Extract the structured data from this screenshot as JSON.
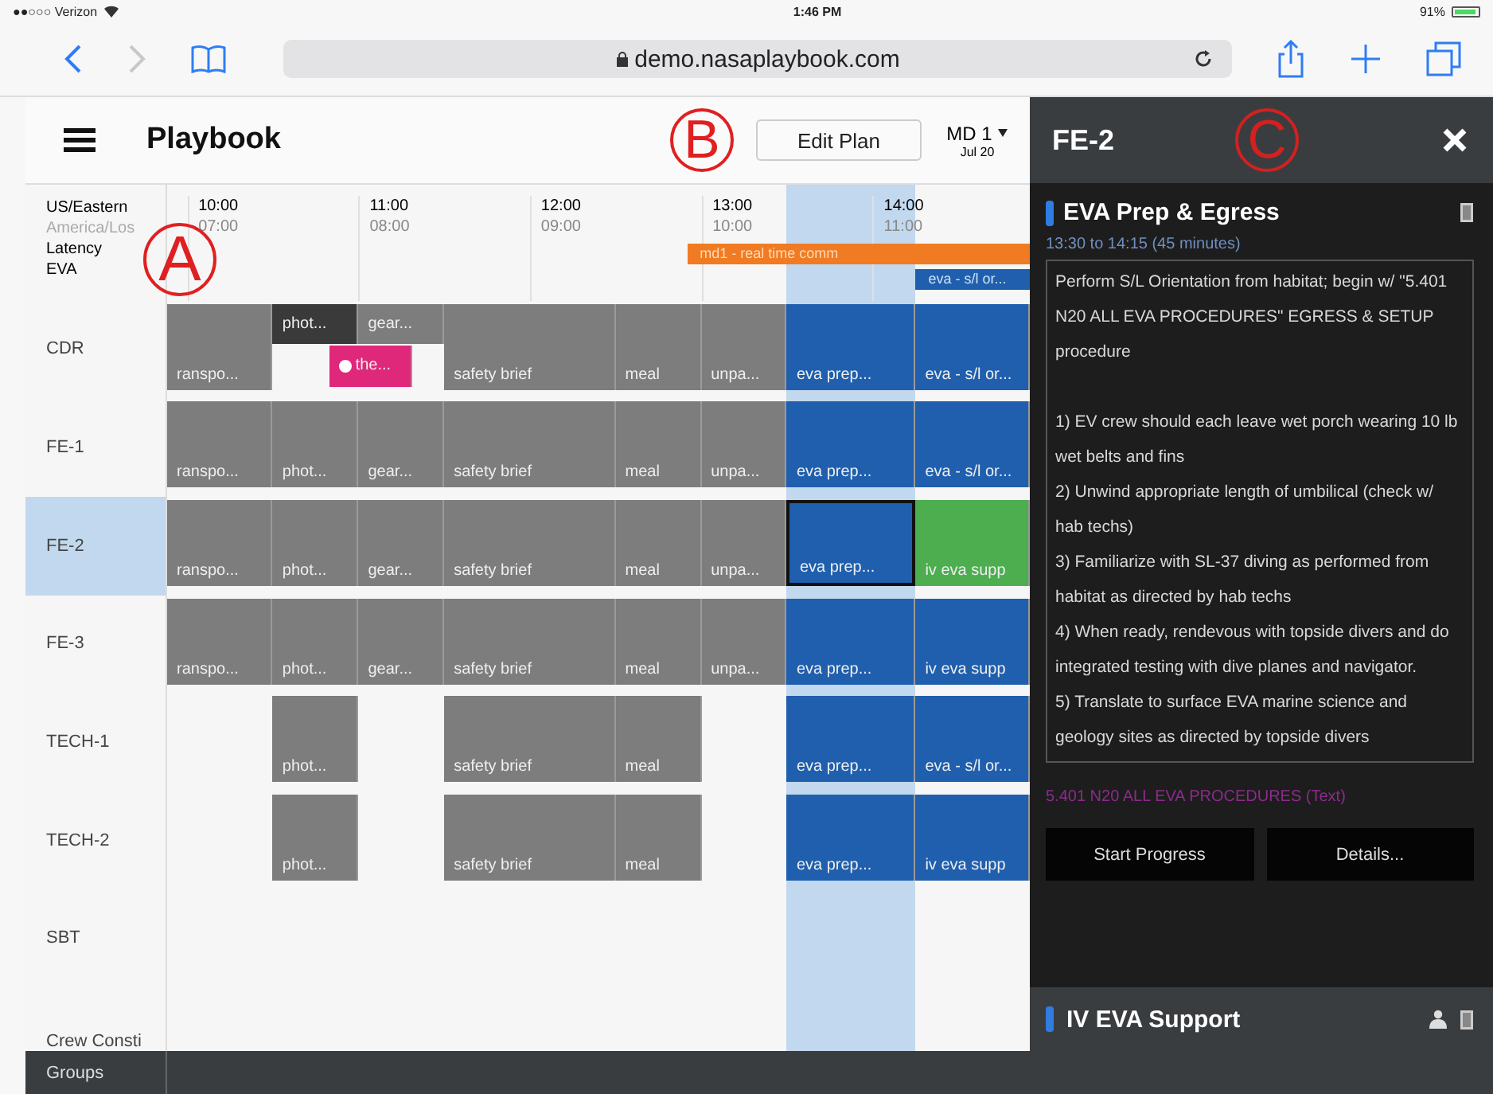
{
  "status_bar": {
    "carrier": "●●○○○ Verizon",
    "time": "1:46 PM",
    "battery": "91%"
  },
  "browser": {
    "url": "demo.nasaplaybook.com",
    "forward_disabled": true
  },
  "header": {
    "title": "Playbook",
    "annotation": "B",
    "edit_button": "Edit Plan",
    "day": "MD 1",
    "date": "Jul 20"
  },
  "timeline": {
    "annotation": "A",
    "zones": [
      "US/Eastern",
      "America/Los"
    ],
    "hours": [
      {
        "time": "10:00",
        "alt": "07:00"
      },
      {
        "time": "11:00",
        "alt": "08:00"
      },
      {
        "time": "12:00",
        "alt": "09:00"
      },
      {
        "time": "13:00",
        "alt": "10:00"
      },
      {
        "time": "14:00",
        "alt": "11:00"
      }
    ],
    "bands": [
      {
        "label": "Latency",
        "bar": {
          "text": "md1 - real time comm",
          "color": "#f07b22"
        }
      },
      {
        "label": "EVA",
        "bar": {
          "text": "eva - s/l or...",
          "color": "#1f5fae"
        }
      }
    ],
    "rows": [
      {
        "label": "CDR",
        "selected": false,
        "blocks": [
          {
            "text": "ranspo...",
            "kind": "full",
            "color": "#7d7d7d",
            "selected": false,
            "dot": false
          },
          {
            "text": "phot...",
            "kind": "upper",
            "color": "#3a3a3a",
            "selected": false,
            "dot": false
          },
          {
            "text": "gear...",
            "kind": "upper",
            "color": "#7d7d7d",
            "selected": false,
            "dot": false
          },
          {
            "text": "the...",
            "kind": "lower",
            "color": "#e0287a",
            "selected": false,
            "dot": true
          },
          {
            "text": "safety brief",
            "kind": "full",
            "color": "#7d7d7d",
            "selected": false,
            "dot": false
          },
          {
            "text": "meal",
            "kind": "full",
            "color": "#7d7d7d",
            "selected": false,
            "dot": false
          },
          {
            "text": "unpa...",
            "kind": "full",
            "color": "#7d7d7d",
            "selected": false,
            "dot": false
          },
          {
            "text": "eva prep...",
            "kind": "full",
            "color": "#1f5fae",
            "selected": false,
            "dot": false
          },
          {
            "text": "eva - s/l or...",
            "kind": "full",
            "color": "#1f5fae",
            "selected": false,
            "dot": false
          }
        ]
      },
      {
        "label": "FE-1",
        "selected": false,
        "blocks": [
          {
            "text": "ranspo...",
            "kind": "full",
            "color": "#7d7d7d",
            "selected": false,
            "dot": false
          },
          {
            "text": "phot...",
            "kind": "full",
            "color": "#7d7d7d",
            "selected": false,
            "dot": false
          },
          {
            "text": "gear...",
            "kind": "full",
            "color": "#7d7d7d",
            "selected": false,
            "dot": false
          },
          {
            "text": "safety brief",
            "kind": "full",
            "color": "#7d7d7d",
            "selected": false,
            "dot": false
          },
          {
            "text": "meal",
            "kind": "full",
            "color": "#7d7d7d",
            "selected": false,
            "dot": false
          },
          {
            "text": "unpa...",
            "kind": "full",
            "color": "#7d7d7d",
            "selected": false,
            "dot": false
          },
          {
            "text": "eva prep...",
            "kind": "full",
            "color": "#1f5fae",
            "selected": false,
            "dot": false
          },
          {
            "text": "eva - s/l or...",
            "kind": "full",
            "color": "#1f5fae",
            "selected": false,
            "dot": false
          }
        ]
      },
      {
        "label": "FE-2",
        "selected": true,
        "blocks": [
          {
            "text": "ranspo...",
            "kind": "full",
            "color": "#7d7d7d",
            "selected": false,
            "dot": false
          },
          {
            "text": "phot...",
            "kind": "full",
            "color": "#7d7d7d",
            "selected": false,
            "dot": false
          },
          {
            "text": "gear...",
            "kind": "full",
            "color": "#7d7d7d",
            "selected": false,
            "dot": false
          },
          {
            "text": "safety brief",
            "kind": "full",
            "color": "#7d7d7d",
            "selected": false,
            "dot": false
          },
          {
            "text": "meal",
            "kind": "full",
            "color": "#7d7d7d",
            "selected": false,
            "dot": false
          },
          {
            "text": "unpa...",
            "kind": "full",
            "color": "#7d7d7d",
            "selected": false,
            "dot": false
          },
          {
            "text": "eva prep...",
            "kind": "full",
            "color": "#1f5fae",
            "selected": true,
            "dot": false
          },
          {
            "text": "iv eva supp",
            "kind": "full",
            "color": "#4cae4f",
            "selected": false,
            "dot": false
          }
        ]
      },
      {
        "label": "FE-3",
        "selected": false,
        "blocks": [
          {
            "text": "ranspo...",
            "kind": "full",
            "color": "#7d7d7d",
            "selected": false,
            "dot": false
          },
          {
            "text": "phot...",
            "kind": "full",
            "color": "#7d7d7d",
            "selected": false,
            "dot": false
          },
          {
            "text": "gear...",
            "kind": "full",
            "color": "#7d7d7d",
            "selected": false,
            "dot": false
          },
          {
            "text": "safety brief",
            "kind": "full",
            "color": "#7d7d7d",
            "selected": false,
            "dot": false
          },
          {
            "text": "meal",
            "kind": "full",
            "color": "#7d7d7d",
            "selected": false,
            "dot": false
          },
          {
            "text": "unpa...",
            "kind": "full",
            "color": "#7d7d7d",
            "selected": false,
            "dot": false
          },
          {
            "text": "eva prep...",
            "kind": "full",
            "color": "#1f5fae",
            "selected": false,
            "dot": false
          },
          {
            "text": "iv eva supp",
            "kind": "full",
            "color": "#1f5fae",
            "selected": false,
            "dot": false
          }
        ]
      },
      {
        "label": "TECH-1",
        "selected": false,
        "blocks": [
          {
            "text": "phot...",
            "kind": "full",
            "color": "#7d7d7d",
            "selected": false,
            "dot": false
          },
          {
            "text": "safety brief",
            "kind": "full",
            "color": "#7d7d7d",
            "selected": false,
            "dot": false
          },
          {
            "text": "meal",
            "kind": "full",
            "color": "#7d7d7d",
            "selected": false,
            "dot": false
          },
          {
            "text": "eva prep...",
            "kind": "full",
            "color": "#1f5fae",
            "selected": false,
            "dot": false
          },
          {
            "text": "eva - s/l or...",
            "kind": "full",
            "color": "#1f5fae",
            "selected": false,
            "dot": false
          }
        ]
      },
      {
        "label": "TECH-2",
        "selected": false,
        "blocks": [
          {
            "text": "phot...",
            "kind": "full",
            "color": "#7d7d7d",
            "selected": false,
            "dot": false
          },
          {
            "text": "safety brief",
            "kind": "full",
            "color": "#7d7d7d",
            "selected": false,
            "dot": false
          },
          {
            "text": "meal",
            "kind": "full",
            "color": "#7d7d7d",
            "selected": false,
            "dot": false
          },
          {
            "text": "eva prep...",
            "kind": "full",
            "color": "#1f5fae",
            "selected": false,
            "dot": false
          },
          {
            "text": "iv eva supp",
            "kind": "full",
            "color": "#1f5fae",
            "selected": false,
            "dot": false
          }
        ]
      },
      {
        "label": "SBT",
        "selected": false
      },
      {
        "label": "Crew Consti",
        "selected": false
      }
    ],
    "footer": "Groups"
  },
  "panel": {
    "title": "FE-2",
    "annotation": "C",
    "activity": {
      "title": "EVA Prep & Egress",
      "color": "#2f7de1",
      "time": "13:30 to 14:15 (45 minutes)",
      "intro": "Perform S/L Orientation from habitat; begin w/ \"5.401 N20 ALL EVA PROCEDURES\" EGRESS & SETUP procedure",
      "steps": [
        "1) EV crew should each leave wet porch wearing 10 lb wet belts and fins",
        "2) Unwind appropriate length of umbilical (check w/ hab techs)",
        "3) Familiarize with SL-37 diving as performed from habitat as directed by hab techs",
        "4) When ready, rendevous with topside divers and do integrated testing with dive planes and navigator.",
        "5) Translate to surface EVA marine science and geology sites as directed by topside divers"
      ],
      "link": "5.401 N20 ALL EVA PROCEDURES (Text)",
      "buttons": [
        "Start Progress",
        "Details..."
      ]
    },
    "next": {
      "title": "IV EVA Support",
      "color": "#2f7de1"
    }
  }
}
